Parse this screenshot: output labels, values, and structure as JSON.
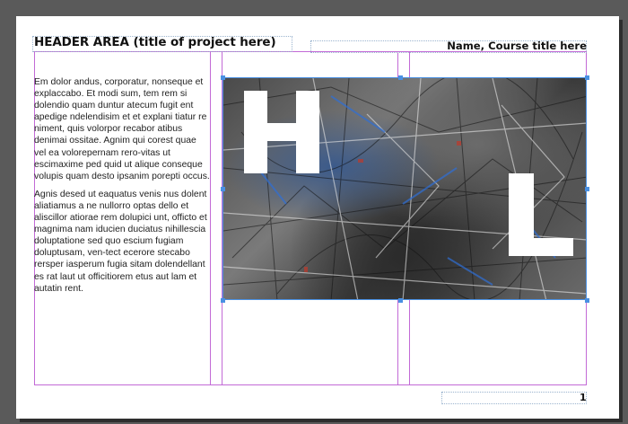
{
  "header": {
    "title": "HEADER AREA (title of project here)",
    "name_course": "Name, Course title here"
  },
  "body_text": {
    "paragraph_1": "Em dolor andus, corporatur, nonseque et explaccabo. Et modi sum, tem rem si dolendio quam duntur atecum fugit ent apedige ndelendisim et et explani tiatur re niment, quis volorpor recabor atibus denimai ossitae. Agnim qui corest quae vel ea volorepernam rero-vitas ut escimaxime ped quid ut alique conseque volupis quam desto ipsanim porepti occus.",
    "paragraph_2": "Agnis desed ut eaquatus venis nus dolent aliatiamus a ne nullorro optas dello et aliscillor atiorae rem dolupici unt, officto et magnima nam iducien duciatus nihillescia doluptatione sed quo escium fugiam doluptusam, ven-tect ecerore stecabo rersper iasperum fugia sitam dolendellant es rat laut ut officitiorem etus aut lam et autatin rent."
  },
  "image_letters": [
    "H",
    "L"
  ],
  "footer": {
    "page_number": "1"
  },
  "colors": {
    "guide": "#c26ad6",
    "frame_selection": "#4a90e2",
    "pasteboard": "#5a5a5a"
  }
}
